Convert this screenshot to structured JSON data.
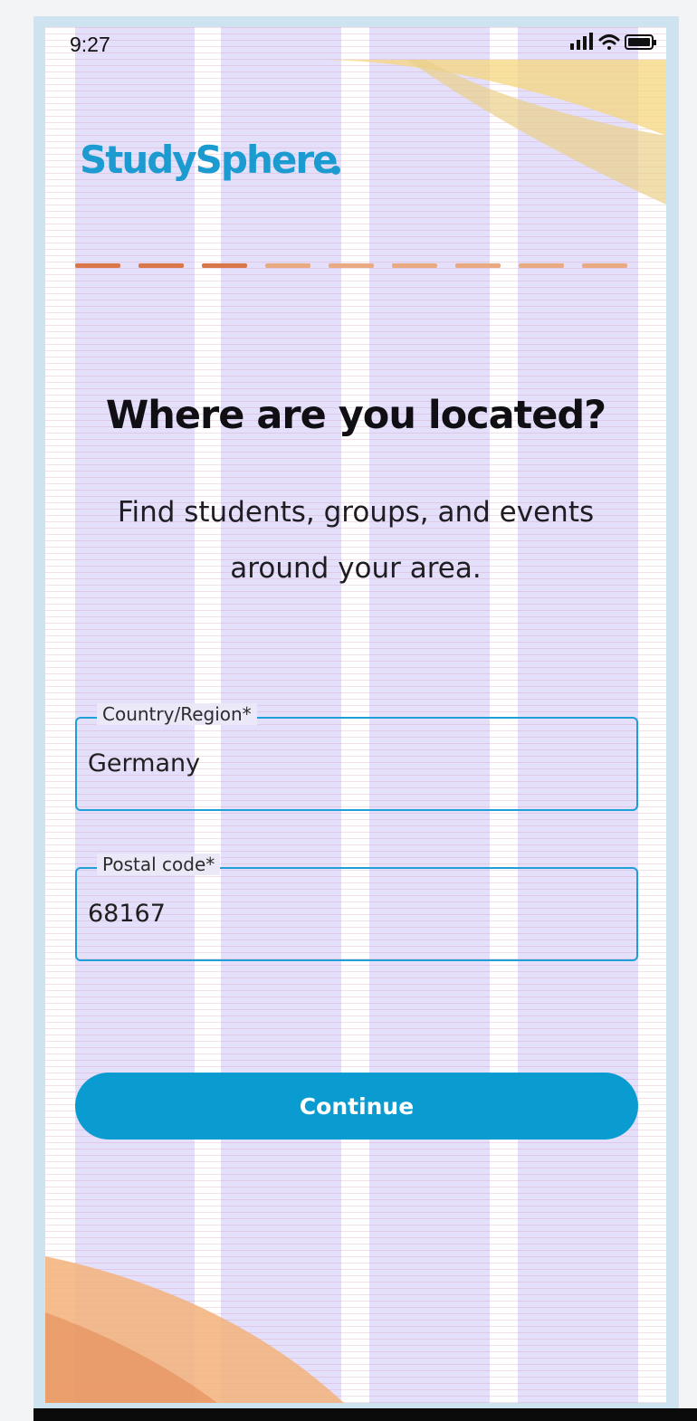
{
  "status_bar": {
    "time": "9:27",
    "icons": [
      "signal-icon",
      "wifi-icon",
      "battery-icon"
    ]
  },
  "brand": {
    "name": "StudySphere",
    "color": "#1b9bd0"
  },
  "progress": {
    "total_steps": 9,
    "completed_steps": 3,
    "active_color": "#d9774a",
    "inactive_color": "#e9a983"
  },
  "header": {
    "title": "Where are you located?",
    "subtitle_line1": "Find students, groups, and events",
    "subtitle_line2": "around your area."
  },
  "form": {
    "country": {
      "label": "Country/Region*",
      "value": "Germany"
    },
    "postal_code": {
      "label": "Postal code*",
      "value": "68167"
    }
  },
  "actions": {
    "continue_label": "Continue"
  },
  "colors": {
    "accent": "#0a9bd1",
    "field_border": "#1e9fd6",
    "deco_yellow": "#f4d88a",
    "deco_orange": "#f2a15c"
  }
}
